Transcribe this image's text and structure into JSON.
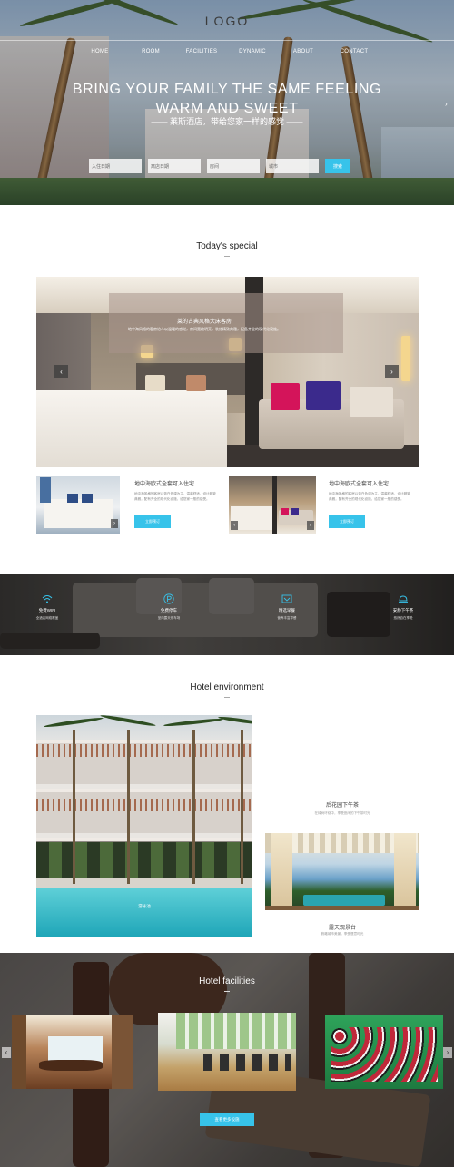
{
  "header": {
    "logo": "LOGO",
    "nav": [
      "HOME",
      "ROOM",
      "FACILITIES",
      "DYNAMIC",
      "ABOUT",
      "CONTACT"
    ]
  },
  "hero": {
    "title_line1": "BRING YOUR FAMILY THE SAME FEELING",
    "title_line2": "WARM AND SWEET",
    "subtitle": "—— 莱斯酒店，带给您家一样的感觉 ——",
    "search_fields": [
      "入住日期",
      "离店日期",
      "房间",
      "城市"
    ],
    "search_button": "搜索"
  },
  "special": {
    "title": "Today's special",
    "slide_caption_title": "莱的古典风格大床客房",
    "slide_caption_text": "地中海风格的客房给人以温暖的感觉，房间宽敞明亮，装修精致典雅，配备齐全的现代化设施。",
    "cards": [
      {
        "title": "地中海欧式全套可入住宅",
        "desc": "地中海风格的客房以蓝白色调为主，温馨舒适，设计精致典雅，配有齐全的现代化设施，给您家一般的感受。",
        "button": "立即预订"
      },
      {
        "title": "地中海欧式全套可入住宅",
        "desc": "地中海风格的客房以蓝白色调为主，温馨舒适，设计精致典雅，配有齐全的现代化设施，给您家一般的感受。",
        "button": "立即预订"
      }
    ]
  },
  "features": [
    {
      "icon": "wifi-icon",
      "title": "免费WIFI",
      "desc": "全酒店网络覆盖"
    },
    {
      "icon": "parking-icon",
      "title": "免费停车",
      "desc": "室内露天停车场"
    },
    {
      "icon": "breakfast-icon",
      "title": "精选早餐",
      "desc": "营养丰富早餐"
    },
    {
      "icon": "tea-icon",
      "title": "安静下午茶",
      "desc": "悠然自在享受"
    }
  ],
  "environment": {
    "title": "Hotel environment",
    "pool_caption": "游泳池",
    "item1_title": "后花园下午茶",
    "item1_desc": "在绿树环绕中，享受悠闲的下午茶时光",
    "item2_title": "露天观景台",
    "item2_desc": "俯瞰城市美景，享受惬意时光"
  },
  "facilities": {
    "title": "Hotel facilities",
    "more_button": "查看更多设施"
  },
  "colors": {
    "accent": "#37c3ea"
  }
}
